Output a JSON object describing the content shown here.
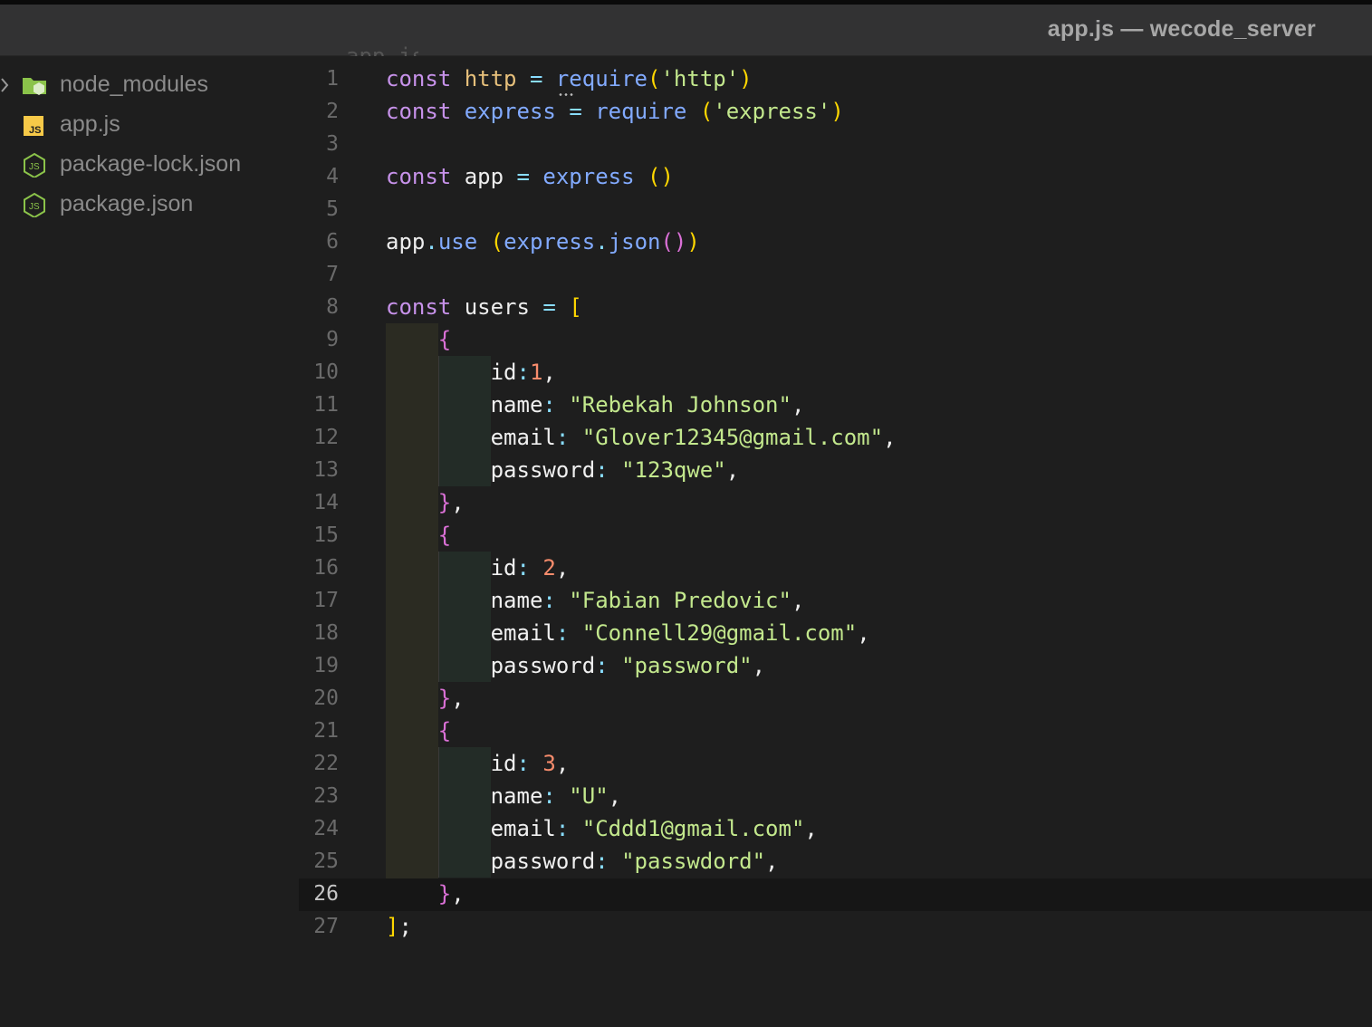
{
  "window": {
    "title": "app.js — wecode_server"
  },
  "explorer": {
    "items": [
      {
        "name": "node_modules",
        "icon": "folder-node-icon"
      },
      {
        "name": "app.js",
        "icon": "js-file-icon"
      },
      {
        "name": "package-lock.json",
        "icon": "nodejs-file-icon"
      },
      {
        "name": "package.json",
        "icon": "nodejs-file-icon"
      }
    ]
  },
  "editor": {
    "current_line": 26,
    "lines": [
      {
        "n": "1",
        "tokens": [
          [
            "kw",
            "const"
          ],
          [
            "plain",
            " "
          ],
          [
            "var",
            "http"
          ],
          [
            "plain",
            " "
          ],
          [
            "pun",
            "="
          ],
          [
            "plain",
            " "
          ],
          [
            "fn",
            "require"
          ],
          [
            "br1",
            "("
          ],
          [
            "str",
            "'http'"
          ],
          [
            "br1",
            ")"
          ]
        ]
      },
      {
        "n": "2",
        "tokens": [
          [
            "kw",
            "const"
          ],
          [
            "plain",
            " "
          ],
          [
            "fn",
            "express"
          ],
          [
            "plain",
            " "
          ],
          [
            "pun",
            "="
          ],
          [
            "plain",
            " "
          ],
          [
            "fn",
            "require"
          ],
          [
            "plain",
            " "
          ],
          [
            "br1",
            "("
          ],
          [
            "str",
            "'express'"
          ],
          [
            "br1",
            ")"
          ]
        ]
      },
      {
        "n": "3",
        "tokens": []
      },
      {
        "n": "4",
        "tokens": [
          [
            "kw",
            "const"
          ],
          [
            "plain",
            " app "
          ],
          [
            "pun",
            "="
          ],
          [
            "plain",
            " "
          ],
          [
            "fn",
            "express"
          ],
          [
            "plain",
            " "
          ],
          [
            "br1",
            "()"
          ]
        ]
      },
      {
        "n": "5",
        "tokens": []
      },
      {
        "n": "6",
        "tokens": [
          [
            "plain",
            "app"
          ],
          [
            "pun",
            "."
          ],
          [
            "fn",
            "use"
          ],
          [
            "plain",
            " "
          ],
          [
            "br1",
            "("
          ],
          [
            "fn",
            "express"
          ],
          [
            "pun",
            "."
          ],
          [
            "fn",
            "json"
          ],
          [
            "br2",
            "()"
          ],
          [
            "br1",
            ")"
          ]
        ]
      },
      {
        "n": "7",
        "tokens": []
      },
      {
        "n": "8",
        "tokens": [
          [
            "kw",
            "const"
          ],
          [
            "plain",
            " users "
          ],
          [
            "pun",
            "="
          ],
          [
            "plain",
            " "
          ],
          [
            "br1",
            "["
          ]
        ]
      },
      {
        "n": "9",
        "tokens": [
          [
            "plain",
            "    "
          ],
          [
            "br2",
            "{"
          ]
        ]
      },
      {
        "n": "10",
        "tokens": [
          [
            "plain",
            "        "
          ],
          [
            "prop",
            "id"
          ],
          [
            "pun",
            ":"
          ],
          [
            "num",
            "1"
          ],
          [
            "plain",
            ","
          ]
        ]
      },
      {
        "n": "11",
        "tokens": [
          [
            "plain",
            "        "
          ],
          [
            "prop",
            "name"
          ],
          [
            "pun",
            ":"
          ],
          [
            "plain",
            " "
          ],
          [
            "str",
            "\"Rebekah Johnson\""
          ],
          [
            "plain",
            ","
          ]
        ]
      },
      {
        "n": "12",
        "tokens": [
          [
            "plain",
            "        "
          ],
          [
            "prop",
            "email"
          ],
          [
            "pun",
            ":"
          ],
          [
            "plain",
            " "
          ],
          [
            "str",
            "\"Glover12345@gmail.com\""
          ],
          [
            "plain",
            ","
          ]
        ]
      },
      {
        "n": "13",
        "tokens": [
          [
            "plain",
            "        "
          ],
          [
            "prop",
            "password"
          ],
          [
            "pun",
            ":"
          ],
          [
            "plain",
            " "
          ],
          [
            "str",
            "\"123qwe\""
          ],
          [
            "plain",
            ","
          ]
        ]
      },
      {
        "n": "14",
        "tokens": [
          [
            "plain",
            "    "
          ],
          [
            "br2",
            "}"
          ],
          [
            "plain",
            ","
          ]
        ]
      },
      {
        "n": "15",
        "tokens": [
          [
            "plain",
            "    "
          ],
          [
            "br2",
            "{"
          ]
        ]
      },
      {
        "n": "16",
        "tokens": [
          [
            "plain",
            "        "
          ],
          [
            "prop",
            "id"
          ],
          [
            "pun",
            ":"
          ],
          [
            "plain",
            " "
          ],
          [
            "num",
            "2"
          ],
          [
            "plain",
            ","
          ]
        ]
      },
      {
        "n": "17",
        "tokens": [
          [
            "plain",
            "        "
          ],
          [
            "prop",
            "name"
          ],
          [
            "pun",
            ":"
          ],
          [
            "plain",
            " "
          ],
          [
            "str",
            "\"Fabian Predovic\""
          ],
          [
            "plain",
            ","
          ]
        ]
      },
      {
        "n": "18",
        "tokens": [
          [
            "plain",
            "        "
          ],
          [
            "prop",
            "email"
          ],
          [
            "pun",
            ":"
          ],
          [
            "plain",
            " "
          ],
          [
            "str",
            "\"Connell29@gmail.com\""
          ],
          [
            "plain",
            ","
          ]
        ]
      },
      {
        "n": "19",
        "tokens": [
          [
            "plain",
            "        "
          ],
          [
            "prop",
            "password"
          ],
          [
            "pun",
            ":"
          ],
          [
            "plain",
            " "
          ],
          [
            "str",
            "\"password\""
          ],
          [
            "plain",
            ","
          ]
        ]
      },
      {
        "n": "20",
        "tokens": [
          [
            "plain",
            "    "
          ],
          [
            "br2",
            "}"
          ],
          [
            "plain",
            ","
          ]
        ]
      },
      {
        "n": "21",
        "tokens": [
          [
            "plain",
            "    "
          ],
          [
            "br2",
            "{"
          ]
        ]
      },
      {
        "n": "22",
        "tokens": [
          [
            "plain",
            "        "
          ],
          [
            "prop",
            "id"
          ],
          [
            "pun",
            ":"
          ],
          [
            "plain",
            " "
          ],
          [
            "num",
            "3"
          ],
          [
            "plain",
            ","
          ]
        ]
      },
      {
        "n": "23",
        "tokens": [
          [
            "plain",
            "        "
          ],
          [
            "prop",
            "name"
          ],
          [
            "pun",
            ":"
          ],
          [
            "plain",
            " "
          ],
          [
            "str",
            "\"U\""
          ],
          [
            "plain",
            ","
          ]
        ]
      },
      {
        "n": "24",
        "tokens": [
          [
            "plain",
            "        "
          ],
          [
            "prop",
            "email"
          ],
          [
            "pun",
            ":"
          ],
          [
            "plain",
            " "
          ],
          [
            "str",
            "\"Cddd1@gmail.com\""
          ],
          [
            "plain",
            ","
          ]
        ]
      },
      {
        "n": "25",
        "tokens": [
          [
            "plain",
            "        "
          ],
          [
            "prop",
            "password"
          ],
          [
            "pun",
            ":"
          ],
          [
            "plain",
            " "
          ],
          [
            "str",
            "\"passwdord\""
          ],
          [
            "plain",
            ","
          ]
        ]
      },
      {
        "n": "26",
        "tokens": [
          [
            "plain",
            "    "
          ],
          [
            "br2",
            "}"
          ],
          [
            "plain",
            ","
          ]
        ]
      },
      {
        "n": "27",
        "tokens": [
          [
            "br1",
            "]"
          ],
          [
            "plain",
            ";"
          ]
        ]
      }
    ]
  }
}
